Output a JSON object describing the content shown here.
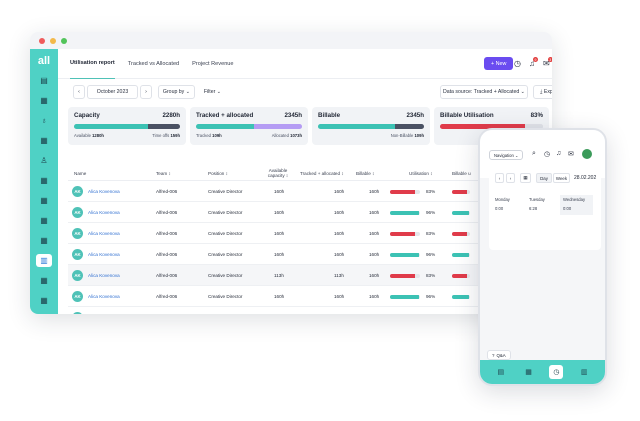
{
  "window": {
    "dots": [
      "#ef5b5b",
      "#f3b94a",
      "#52c45a"
    ]
  },
  "sidebar": {
    "logo": "all",
    "icons": [
      "clipboard-icon",
      "dashboard-icon",
      "money-bag-icon",
      "grid-icon",
      "handshake-icon",
      "grid-icon",
      "grid-icon",
      "grid-icon",
      "grid-icon",
      "chart-icon",
      "grid-icon",
      "grid-icon"
    ],
    "glyphs": [
      "▤",
      "▦",
      "♁",
      "▦",
      "♙",
      "▦",
      "▦",
      "▦",
      "▦",
      "▥",
      "▦",
      "▦"
    ],
    "active_index": 9
  },
  "topnav": {
    "tabs": [
      "Utilisation report",
      "Tracked vs Allocated",
      "Project Revenue"
    ],
    "active_tab": 0,
    "new_label": "+ New",
    "notif_badge": "9",
    "msg_badge": "3",
    "avatar": "AB"
  },
  "toolbar": {
    "prev": "‹",
    "period": "October 2023",
    "next": "›",
    "group_by": "Group by ⌄",
    "filter": "Filter ⌄",
    "data_source": "Data source: Tracked + Allocated ⌄",
    "export": "⤓ Export"
  },
  "cards": [
    {
      "title": "Capacity",
      "value": "2280h",
      "left_label": "Available",
      "left_value": "1280h",
      "right_label": "Time offs",
      "right_value": "159h",
      "segments": [
        {
          "pct": 70,
          "color": "#3cc2b4"
        },
        {
          "pct": 30,
          "color": "#4a5163"
        }
      ]
    },
    {
      "title": "Tracked + allocated",
      "value": "2345h",
      "left_label": "Tracked",
      "left_value": "109h",
      "right_label": "Allocated",
      "right_value": "1073h",
      "segments": [
        {
          "pct": 55,
          "color": "#3cc2b4"
        },
        {
          "pct": 45,
          "color": "#b59cf4"
        }
      ]
    },
    {
      "title": "Billable",
      "value": "2345h",
      "left_label": "",
      "left_value": "",
      "right_label": "Non-Billable",
      "right_value": "109h",
      "segments": [
        {
          "pct": 73,
          "color": "#3cc2b4"
        },
        {
          "pct": 27,
          "color": "#4a5163"
        }
      ]
    },
    {
      "title": "Billable Utilisation",
      "value": "83%",
      "left_label": "",
      "left_value": "",
      "right_label": "",
      "right_value": "",
      "segments": [
        {
          "pct": 83,
          "color": "#e03b4a"
        },
        {
          "pct": 17,
          "color": "#dfe2e8"
        }
      ]
    }
  ],
  "table": {
    "headers": [
      "Name",
      "Team ↕",
      "Position ↕",
      "Available capacity ↕",
      "Tracked + allocated ↕",
      "Billable ↕",
      "Utilisation ↕",
      "Billable u"
    ],
    "rows": [
      {
        "initials": "AK",
        "name": "Alica Kovenova",
        "team": "Alfred-006",
        "position": "Creative Director",
        "available": "160h",
        "tracked": "160h",
        "billable": "160h",
        "util": "83%",
        "util_pct": 83,
        "util_color": "#e03b4a"
      },
      {
        "initials": "AK",
        "name": "Alica Kovenova",
        "team": "Alfred-006",
        "position": "Creative Director",
        "available": "160h",
        "tracked": "160h",
        "billable": "160h",
        "util": "96%",
        "util_pct": 96,
        "util_color": "#3cc2b4"
      },
      {
        "initials": "AK",
        "name": "Alica Kovenova",
        "team": "Alfred-006",
        "position": "Creative Director",
        "available": "160h",
        "tracked": "160h",
        "billable": "160h",
        "util": "83%",
        "util_pct": 83,
        "util_color": "#e03b4a"
      },
      {
        "initials": "AK",
        "name": "Alica Kovenova",
        "team": "Alfred-006",
        "position": "Creative Director",
        "available": "160h",
        "tracked": "160h",
        "billable": "160h",
        "util": "96%",
        "util_pct": 96,
        "util_color": "#3cc2b4"
      },
      {
        "initials": "AK",
        "name": "Alica Kovenova",
        "team": "Alfred-006",
        "position": "Creative Director",
        "available": "113h",
        "tracked": "113h",
        "billable": "160h",
        "util": "83%",
        "util_pct": 83,
        "util_color": "#e03b4a"
      },
      {
        "initials": "AK",
        "name": "Alica Kovenova",
        "team": "Alfred-006",
        "position": "Creative Director",
        "available": "160h",
        "tracked": "160h",
        "billable": "160h",
        "util": "96%",
        "util_pct": 96,
        "util_color": "#3cc2b4"
      },
      {
        "initials": "AK",
        "name": "Alica Kovenova",
        "team": "Alfred-006",
        "position": "Creative Director",
        "available": "160h",
        "tracked": "160h",
        "billable": "160h",
        "util": "96%",
        "util_pct": 96,
        "util_color": "#3cc2b4"
      }
    ]
  },
  "phone": {
    "navigation": "Navigation ⌄",
    "prev": "‹",
    "next": "›",
    "day": "Day",
    "week": "Week",
    "date": "28.02.202",
    "days": [
      {
        "name": "Monday",
        "value": "0:00"
      },
      {
        "name": "Tuesday",
        "value": "6:28"
      },
      {
        "name": "Wednesday",
        "value": "0:00"
      }
    ],
    "qa": "Q&A",
    "bottom_icons": [
      "clipboard-icon",
      "dashboard-icon",
      "clock-icon",
      "chart-icon"
    ],
    "bottom_glyphs": [
      "▤",
      "▦",
      "◷",
      "▥"
    ],
    "bottom_active": 2
  }
}
